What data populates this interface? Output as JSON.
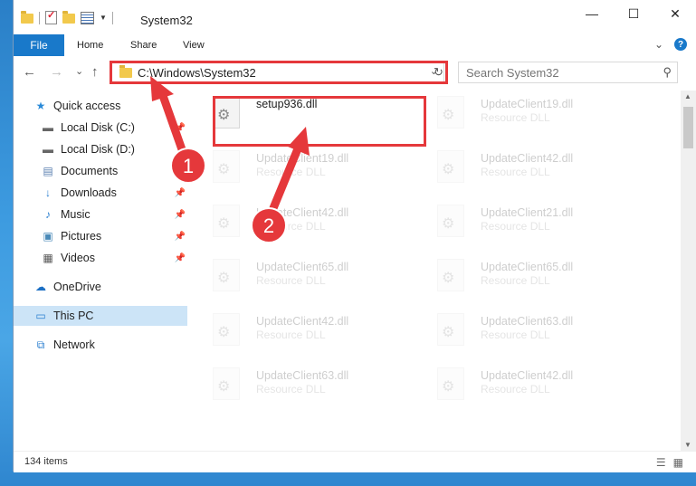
{
  "window": {
    "title": "System32"
  },
  "ribbon": {
    "file": "File",
    "home": "Home",
    "share": "Share",
    "view": "View"
  },
  "controls": {
    "minimize": "—",
    "maximize": "☐",
    "close": "✕"
  },
  "nav": {
    "back": "←",
    "forward": "→",
    "recent": "⌄",
    "up": "↑",
    "address": "C:\\Windows\\System32",
    "search_placeholder": "Search System32"
  },
  "sidebar": {
    "items": [
      {
        "label": "Quick access",
        "icon": "star-icon"
      },
      {
        "label": "Local Disk (C:)",
        "icon": "drive-icon"
      },
      {
        "label": "Local Disk (D:)",
        "icon": "drive-icon"
      },
      {
        "label": "Documents",
        "icon": "documents-icon"
      },
      {
        "label": "Downloads",
        "icon": "download-icon"
      },
      {
        "label": "Music",
        "icon": "music-icon"
      },
      {
        "label": "Pictures",
        "icon": "pictures-icon"
      },
      {
        "label": "Videos",
        "icon": "videos-icon"
      },
      {
        "label": "OneDrive",
        "icon": "cloud-icon"
      },
      {
        "label": "This PC",
        "icon": "pc-icon"
      },
      {
        "label": "Network",
        "icon": "network-icon"
      }
    ]
  },
  "files": [
    {
      "name": "setup936.dll",
      "type": "",
      "highlight": true
    },
    {
      "name": "UpdateClient19.dll",
      "type": "Resource DLL"
    },
    {
      "name": "UpdateClient19.dll",
      "type": "Resource DLL"
    },
    {
      "name": "UpdateClient42.dll",
      "type": "Resource DLL"
    },
    {
      "name": "UpdateClient42.dll",
      "type": "Resource DLL"
    },
    {
      "name": "UpdateClient21.dll",
      "type": "Resource DLL"
    },
    {
      "name": "UpdateClient65.dll",
      "type": "Resource DLL"
    },
    {
      "name": "UpdateClient65.dll",
      "type": "Resource DLL"
    },
    {
      "name": "UpdateClient42.dll",
      "type": "Resource DLL"
    },
    {
      "name": "UpdateClient63.dll",
      "type": "Resource DLL"
    },
    {
      "name": "UpdateClient63.dll",
      "type": "Resource DLL"
    },
    {
      "name": "UpdateClient42.dll",
      "type": "Resource DLL"
    }
  ],
  "status": {
    "count": "134 items"
  },
  "annotations": {
    "badge1": "1",
    "badge2": "2",
    "color": "#e5383b"
  }
}
